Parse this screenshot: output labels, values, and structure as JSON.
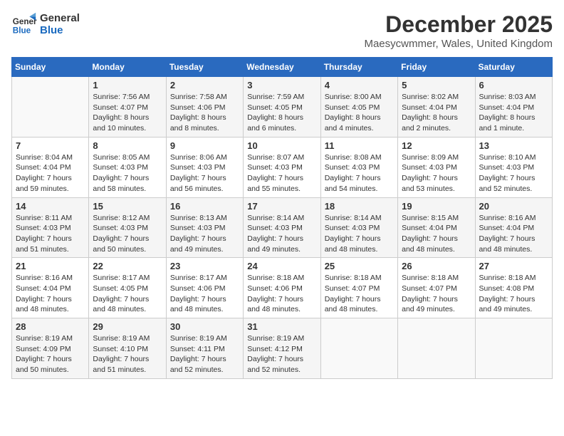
{
  "logo": {
    "line1": "General",
    "line2": "Blue"
  },
  "title": "December 2025",
  "location": "Maesycwmmer, Wales, United Kingdom",
  "days_of_week": [
    "Sunday",
    "Monday",
    "Tuesday",
    "Wednesday",
    "Thursday",
    "Friday",
    "Saturday"
  ],
  "weeks": [
    [
      {
        "day": "",
        "info": ""
      },
      {
        "day": "1",
        "info": "Sunrise: 7:56 AM\nSunset: 4:07 PM\nDaylight: 8 hours\nand 10 minutes."
      },
      {
        "day": "2",
        "info": "Sunrise: 7:58 AM\nSunset: 4:06 PM\nDaylight: 8 hours\nand 8 minutes."
      },
      {
        "day": "3",
        "info": "Sunrise: 7:59 AM\nSunset: 4:05 PM\nDaylight: 8 hours\nand 6 minutes."
      },
      {
        "day": "4",
        "info": "Sunrise: 8:00 AM\nSunset: 4:05 PM\nDaylight: 8 hours\nand 4 minutes."
      },
      {
        "day": "5",
        "info": "Sunrise: 8:02 AM\nSunset: 4:04 PM\nDaylight: 8 hours\nand 2 minutes."
      },
      {
        "day": "6",
        "info": "Sunrise: 8:03 AM\nSunset: 4:04 PM\nDaylight: 8 hours\nand 1 minute."
      }
    ],
    [
      {
        "day": "7",
        "info": "Sunrise: 8:04 AM\nSunset: 4:04 PM\nDaylight: 7 hours\nand 59 minutes."
      },
      {
        "day": "8",
        "info": "Sunrise: 8:05 AM\nSunset: 4:03 PM\nDaylight: 7 hours\nand 58 minutes."
      },
      {
        "day": "9",
        "info": "Sunrise: 8:06 AM\nSunset: 4:03 PM\nDaylight: 7 hours\nand 56 minutes."
      },
      {
        "day": "10",
        "info": "Sunrise: 8:07 AM\nSunset: 4:03 PM\nDaylight: 7 hours\nand 55 minutes."
      },
      {
        "day": "11",
        "info": "Sunrise: 8:08 AM\nSunset: 4:03 PM\nDaylight: 7 hours\nand 54 minutes."
      },
      {
        "day": "12",
        "info": "Sunrise: 8:09 AM\nSunset: 4:03 PM\nDaylight: 7 hours\nand 53 minutes."
      },
      {
        "day": "13",
        "info": "Sunrise: 8:10 AM\nSunset: 4:03 PM\nDaylight: 7 hours\nand 52 minutes."
      }
    ],
    [
      {
        "day": "14",
        "info": "Sunrise: 8:11 AM\nSunset: 4:03 PM\nDaylight: 7 hours\nand 51 minutes."
      },
      {
        "day": "15",
        "info": "Sunrise: 8:12 AM\nSunset: 4:03 PM\nDaylight: 7 hours\nand 50 minutes."
      },
      {
        "day": "16",
        "info": "Sunrise: 8:13 AM\nSunset: 4:03 PM\nDaylight: 7 hours\nand 49 minutes."
      },
      {
        "day": "17",
        "info": "Sunrise: 8:14 AM\nSunset: 4:03 PM\nDaylight: 7 hours\nand 49 minutes."
      },
      {
        "day": "18",
        "info": "Sunrise: 8:14 AM\nSunset: 4:03 PM\nDaylight: 7 hours\nand 48 minutes."
      },
      {
        "day": "19",
        "info": "Sunrise: 8:15 AM\nSunset: 4:04 PM\nDaylight: 7 hours\nand 48 minutes."
      },
      {
        "day": "20",
        "info": "Sunrise: 8:16 AM\nSunset: 4:04 PM\nDaylight: 7 hours\nand 48 minutes."
      }
    ],
    [
      {
        "day": "21",
        "info": "Sunrise: 8:16 AM\nSunset: 4:04 PM\nDaylight: 7 hours\nand 48 minutes."
      },
      {
        "day": "22",
        "info": "Sunrise: 8:17 AM\nSunset: 4:05 PM\nDaylight: 7 hours\nand 48 minutes."
      },
      {
        "day": "23",
        "info": "Sunrise: 8:17 AM\nSunset: 4:06 PM\nDaylight: 7 hours\nand 48 minutes."
      },
      {
        "day": "24",
        "info": "Sunrise: 8:18 AM\nSunset: 4:06 PM\nDaylight: 7 hours\nand 48 minutes."
      },
      {
        "day": "25",
        "info": "Sunrise: 8:18 AM\nSunset: 4:07 PM\nDaylight: 7 hours\nand 48 minutes."
      },
      {
        "day": "26",
        "info": "Sunrise: 8:18 AM\nSunset: 4:07 PM\nDaylight: 7 hours\nand 49 minutes."
      },
      {
        "day": "27",
        "info": "Sunrise: 8:18 AM\nSunset: 4:08 PM\nDaylight: 7 hours\nand 49 minutes."
      }
    ],
    [
      {
        "day": "28",
        "info": "Sunrise: 8:19 AM\nSunset: 4:09 PM\nDaylight: 7 hours\nand 50 minutes."
      },
      {
        "day": "29",
        "info": "Sunrise: 8:19 AM\nSunset: 4:10 PM\nDaylight: 7 hours\nand 51 minutes."
      },
      {
        "day": "30",
        "info": "Sunrise: 8:19 AM\nSunset: 4:11 PM\nDaylight: 7 hours\nand 52 minutes."
      },
      {
        "day": "31",
        "info": "Sunrise: 8:19 AM\nSunset: 4:12 PM\nDaylight: 7 hours\nand 52 minutes."
      },
      {
        "day": "",
        "info": ""
      },
      {
        "day": "",
        "info": ""
      },
      {
        "day": "",
        "info": ""
      }
    ]
  ]
}
